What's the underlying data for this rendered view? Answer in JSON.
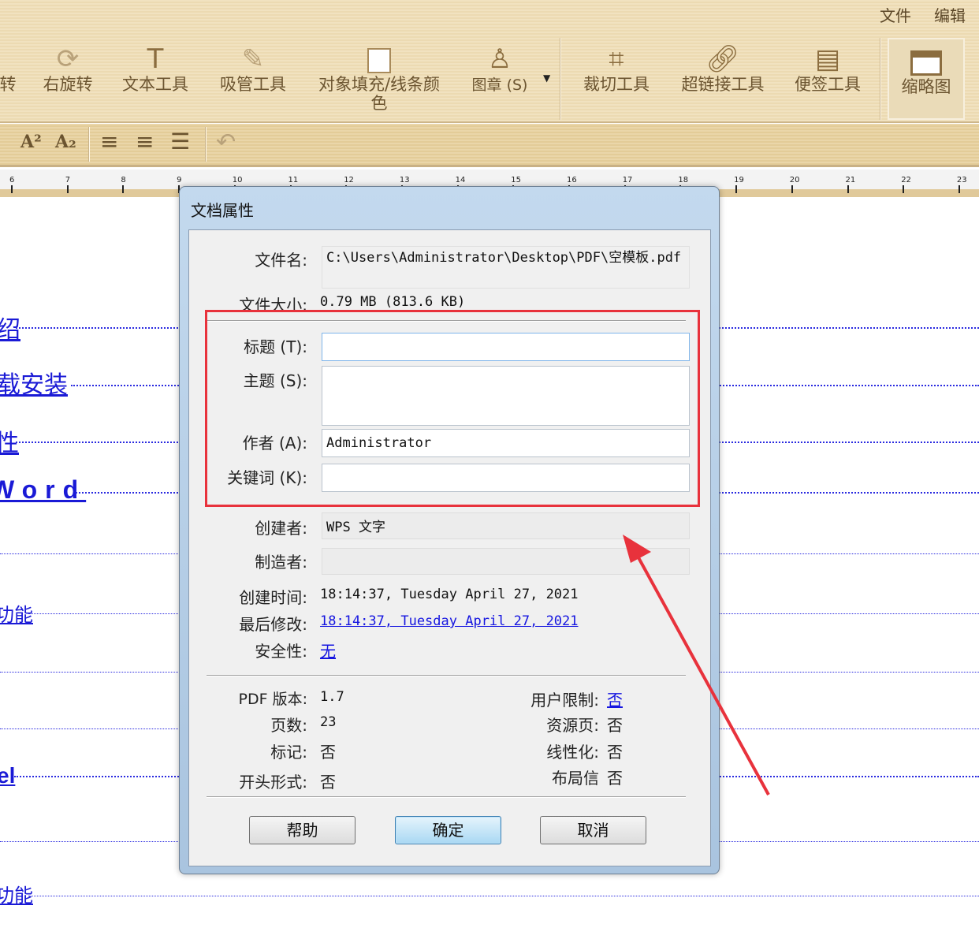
{
  "menu": {
    "file": "文件",
    "edit": "编辑"
  },
  "toolbar": {
    "items": [
      {
        "label": "转",
        "icon": "rotate-left-icon"
      },
      {
        "label": "右旋转",
        "icon": "rotate-right-icon"
      },
      {
        "label": "文本工具",
        "icon": "text-tool-icon"
      },
      {
        "label": "吸管工具",
        "icon": "eyedropper-icon"
      },
      {
        "label": "对象填充/线条颜色",
        "icon": "fill-color-icon"
      },
      {
        "label": "图章 (S)",
        "icon": "stamp-icon"
      },
      {
        "label": "裁切工具",
        "icon": "crop-icon"
      },
      {
        "label": "超链接工具",
        "icon": "link-icon"
      },
      {
        "label": "便签工具",
        "icon": "note-icon"
      },
      {
        "label": "缩略图",
        "icon": "thumbnail-icon"
      }
    ]
  },
  "format_bar": {
    "superscript": "A²",
    "subscript": "A₂"
  },
  "ruler": [
    "6",
    "7",
    "8",
    "9",
    "10",
    "11",
    "12",
    "13",
    "14",
    "15",
    "16",
    "17",
    "18",
    "19",
    "20",
    "21",
    "22",
    "23"
  ],
  "toc": [
    "绍",
    "载安装",
    "性",
    "Word",
    "功能",
    "",
    "el",
    "功能"
  ],
  "dialog": {
    "title": "文档属性",
    "filename_label": "文件名:",
    "filename": "C:\\Users\\Administrator\\Desktop\\PDF\\空模板.pdf",
    "filesize_label": "文件大小:",
    "filesize": "0.79 MB (813.6 KB)",
    "title_label": "标题 (T):",
    "title_value": "",
    "subject_label": "主题 (S):",
    "subject_value": "",
    "author_label": "作者 (A):",
    "author_value": "Administrator",
    "keywords_label": "关键词 (K):",
    "keywords_value": "",
    "creator_label": "创建者:",
    "creator_value": "WPS 文字",
    "producer_label": "制造者:",
    "producer_value": "",
    "created_label": "创建时间:",
    "created": "18:14:37, Tuesday April 27, 2021",
    "modified_label": "最后修改:",
    "modified": "18:14:37, Tuesday April 27, 2021",
    "security_label": "安全性:",
    "security": "无",
    "pdf_version_label": "PDF 版本:",
    "pdf_version": "1.7",
    "pages_label": "页数:",
    "pages": "23",
    "tagged_label": "标记:",
    "tagged": "否",
    "opening_label": "开头形式:",
    "opening": "否",
    "user_restrict_label": "用户限制:",
    "user_restrict": "否",
    "resource_label": "资源页:",
    "resource": "否",
    "linearized_label": "线性化:",
    "linearized": "否",
    "layout_label": "布局信",
    "layout": "否",
    "help": "帮助",
    "ok": "确定",
    "cancel": "取消"
  },
  "colors": {
    "highlight": "#e8323c",
    "link": "#1515e0"
  }
}
